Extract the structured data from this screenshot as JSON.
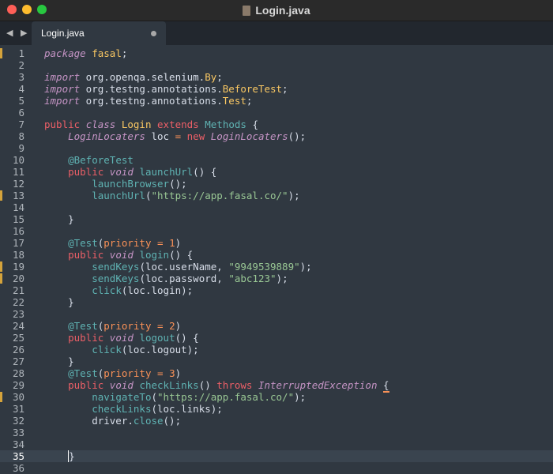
{
  "window": {
    "title": "Login.java"
  },
  "tab": {
    "label": "Login.java"
  },
  "nav": {
    "arrows": "◀ ▶"
  },
  "active_line": 35,
  "modified_lines": [
    1,
    13,
    19,
    20,
    30
  ],
  "lines": [
    [
      [
        "pk",
        "package"
      ],
      [
        "pu",
        " "
      ],
      [
        "cls",
        "fasal"
      ],
      [
        "pu",
        ";"
      ]
    ],
    [],
    [
      [
        "pk",
        "import"
      ],
      [
        "pu",
        " org.openqa.selenium."
      ],
      [
        "cls",
        "By"
      ],
      [
        "pu",
        ";"
      ]
    ],
    [
      [
        "pk",
        "import"
      ],
      [
        "pu",
        " org.testng.annotations."
      ],
      [
        "cls",
        "BeforeTest"
      ],
      [
        "pu",
        ";"
      ]
    ],
    [
      [
        "pk",
        "import"
      ],
      [
        "pu",
        " org.testng.annotations."
      ],
      [
        "cls",
        "Test"
      ],
      [
        "pu",
        ";"
      ]
    ],
    [],
    [
      [
        "k",
        "public"
      ],
      [
        "pu",
        " "
      ],
      [
        "ki",
        "class"
      ],
      [
        "pu",
        " "
      ],
      [
        "cls",
        "Login"
      ],
      [
        "pu",
        " "
      ],
      [
        "k",
        "extends"
      ],
      [
        "pu",
        " "
      ],
      [
        "fn",
        "Methods"
      ],
      [
        "pu",
        " {"
      ]
    ],
    [
      [
        "pu",
        "    "
      ],
      [
        "tyi",
        "LoginLocaters"
      ],
      [
        "pu",
        " loc "
      ],
      [
        "op",
        "="
      ],
      [
        "pu",
        " "
      ],
      [
        "k",
        "new"
      ],
      [
        "pu",
        " "
      ],
      [
        "tyi",
        "LoginLocaters"
      ],
      [
        "pu",
        "();"
      ]
    ],
    [],
    [
      [
        "pu",
        "    "
      ],
      [
        "an",
        "@BeforeTest"
      ]
    ],
    [
      [
        "pu",
        "    "
      ],
      [
        "k",
        "public"
      ],
      [
        "pu",
        " "
      ],
      [
        "ki",
        "void"
      ],
      [
        "pu",
        " "
      ],
      [
        "fn",
        "launchUrl"
      ],
      [
        "pu",
        "() {"
      ]
    ],
    [
      [
        "pu",
        "        "
      ],
      [
        "fn",
        "launchBrowser"
      ],
      [
        "pu",
        "();"
      ]
    ],
    [
      [
        "pu",
        "        "
      ],
      [
        "fn",
        "launchUrl"
      ],
      [
        "pu",
        "("
      ],
      [
        "str",
        "\"https://app.fasal.co/\""
      ],
      [
        "pu",
        ");"
      ]
    ],
    [],
    [
      [
        "pu",
        "    }"
      ]
    ],
    [],
    [
      [
        "pu",
        "    "
      ],
      [
        "an",
        "@Test"
      ],
      [
        "pu",
        "("
      ],
      [
        "ty",
        "priority"
      ],
      [
        "pu",
        " "
      ],
      [
        "op",
        "="
      ],
      [
        "pu",
        " "
      ],
      [
        "num",
        "1"
      ],
      [
        "pu",
        ")"
      ]
    ],
    [
      [
        "pu",
        "    "
      ],
      [
        "k",
        "public"
      ],
      [
        "pu",
        " "
      ],
      [
        "ki",
        "void"
      ],
      [
        "pu",
        " "
      ],
      [
        "fn",
        "login"
      ],
      [
        "pu",
        "() {"
      ]
    ],
    [
      [
        "pu",
        "        "
      ],
      [
        "fn",
        "sendKeys"
      ],
      [
        "pu",
        "(loc.userName, "
      ],
      [
        "str",
        "\"9949539889\""
      ],
      [
        "pu",
        ");"
      ]
    ],
    [
      [
        "pu",
        "        "
      ],
      [
        "fn",
        "sendKeys"
      ],
      [
        "pu",
        "(loc.password, "
      ],
      [
        "str",
        "\"abc123\""
      ],
      [
        "pu",
        ");"
      ]
    ],
    [
      [
        "pu",
        "        "
      ],
      [
        "fn",
        "click"
      ],
      [
        "pu",
        "(loc.login);"
      ]
    ],
    [
      [
        "pu",
        "    }"
      ]
    ],
    [],
    [
      [
        "pu",
        "    "
      ],
      [
        "an",
        "@Test"
      ],
      [
        "pu",
        "("
      ],
      [
        "ty",
        "priority"
      ],
      [
        "pu",
        " "
      ],
      [
        "op",
        "="
      ],
      [
        "pu",
        " "
      ],
      [
        "num",
        "2"
      ],
      [
        "pu",
        ")"
      ]
    ],
    [
      [
        "pu",
        "    "
      ],
      [
        "k",
        "public"
      ],
      [
        "pu",
        " "
      ],
      [
        "ki",
        "void"
      ],
      [
        "pu",
        " "
      ],
      [
        "fn",
        "logout"
      ],
      [
        "pu",
        "() {"
      ]
    ],
    [
      [
        "pu",
        "        "
      ],
      [
        "fn",
        "click"
      ],
      [
        "pu",
        "(loc.logout);"
      ]
    ],
    [
      [
        "pu",
        "    }"
      ]
    ],
    [
      [
        "pu",
        "    "
      ],
      [
        "an",
        "@Test"
      ],
      [
        "pu",
        "("
      ],
      [
        "ty",
        "priority"
      ],
      [
        "pu",
        " "
      ],
      [
        "op",
        "="
      ],
      [
        "pu",
        " "
      ],
      [
        "num",
        "3"
      ],
      [
        "pu",
        ")"
      ]
    ],
    [
      [
        "pu",
        "    "
      ],
      [
        "k",
        "public"
      ],
      [
        "pu",
        " "
      ],
      [
        "ki",
        "void"
      ],
      [
        "pu",
        " "
      ],
      [
        "fn",
        "checkLinks"
      ],
      [
        "pu",
        "() "
      ],
      [
        "k",
        "throws"
      ],
      [
        "pu",
        " "
      ],
      [
        "ex",
        "InterruptedException"
      ],
      [
        "pu",
        " "
      ],
      [
        "ul",
        "{"
      ]
    ],
    [
      [
        "pu",
        "        "
      ],
      [
        "fn",
        "navigateTo"
      ],
      [
        "pu",
        "("
      ],
      [
        "str",
        "\"https://app.fasal.co/\""
      ],
      [
        "pu",
        ");"
      ]
    ],
    [
      [
        "pu",
        "        "
      ],
      [
        "fn",
        "checkLinks"
      ],
      [
        "pu",
        "(loc.links);"
      ]
    ],
    [
      [
        "pu",
        "        driver."
      ],
      [
        "fn",
        "close"
      ],
      [
        "pu",
        "();"
      ]
    ],
    [],
    [],
    [
      [
        "pu",
        "    "
      ],
      [
        "cursor",
        "}"
      ]
    ],
    []
  ]
}
